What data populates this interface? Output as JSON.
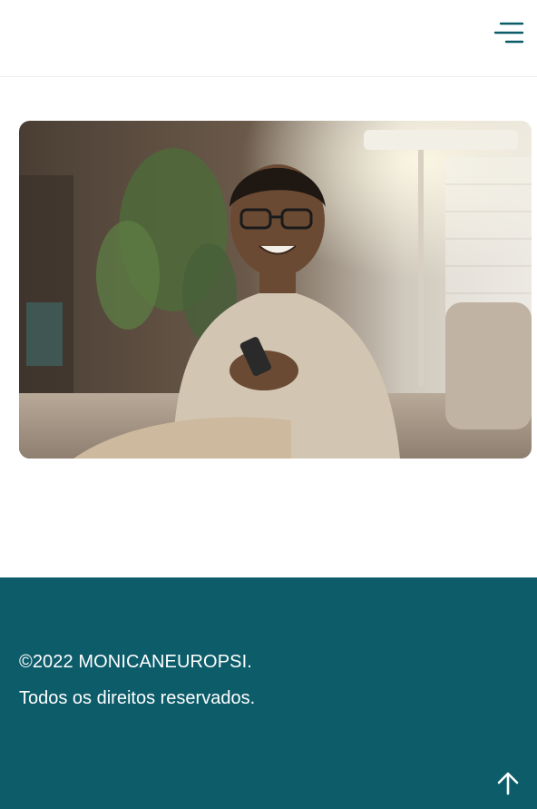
{
  "header": {
    "menu_icon": "hamburger-menu-icon"
  },
  "hero": {
    "image": "smiling-man-with-phone-photo"
  },
  "footer": {
    "copyright": "©2022 MONICANEUROPSI.",
    "rights": "Todos os direitos reservados.",
    "back_to_top_icon": "arrow-up-icon"
  },
  "colors": {
    "footer_bg": "#0d5c6a",
    "accent": "#0d5c6a",
    "text_on_footer": "#ffffff"
  }
}
